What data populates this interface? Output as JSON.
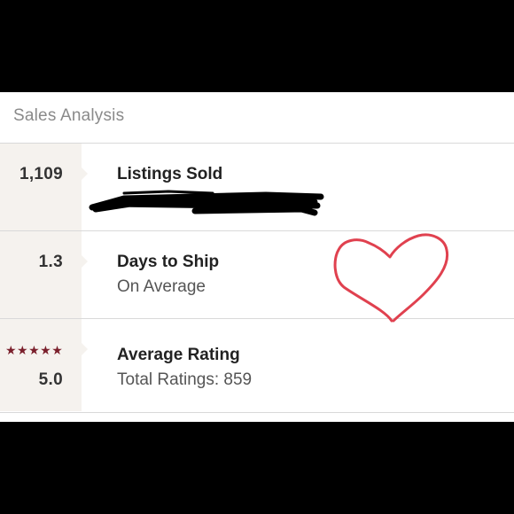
{
  "header": {
    "title": "Sales Analysis"
  },
  "rows": [
    {
      "stat": "1,109",
      "title": "Listings Sold",
      "subtitle": ""
    },
    {
      "stat": "1.3",
      "title": "Days to Ship",
      "subtitle": "On Average"
    },
    {
      "stat": "5.0",
      "stars": "★★★★★",
      "title": "Average Rating",
      "subtitle": "Total Ratings: 859"
    }
  ],
  "colors": {
    "accent_star": "#7a1f2b",
    "heart_doodle": "#e0414f",
    "scribble": "#000000",
    "stat_column_bg": "#f5f2ee"
  },
  "rating": {
    "stars_filled": 5,
    "stars_total": 5
  },
  "annotations": {
    "redaction": "black marker scribble",
    "doodle": "red hand-drawn heart"
  }
}
